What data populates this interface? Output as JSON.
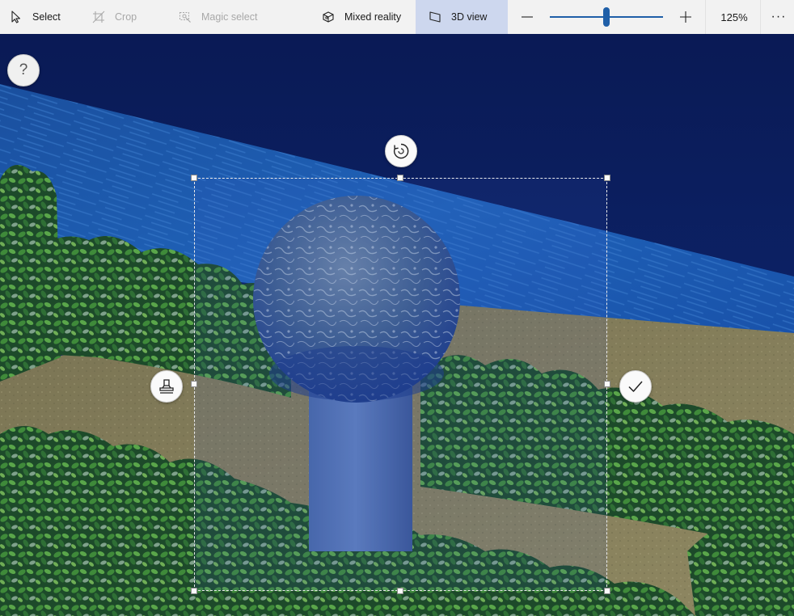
{
  "toolbar": {
    "select_label": "Select",
    "crop_label": "Crop",
    "magic_select_label": "Magic select",
    "mixed_reality_label": "Mixed reality",
    "view3d_label": "3D view",
    "zoom_minus": "−",
    "zoom_plus": "+",
    "zoom_level": "125%",
    "zoom_fraction": 0.5,
    "more_label": "···",
    "active_bg": "#cdd7ee",
    "accent": "#1f5fa8"
  },
  "canvas": {
    "help_label": "?",
    "icons": {
      "rotate": "rotate-icon",
      "stamp": "stamp-icon",
      "confirm": "checkmark-icon"
    }
  }
}
